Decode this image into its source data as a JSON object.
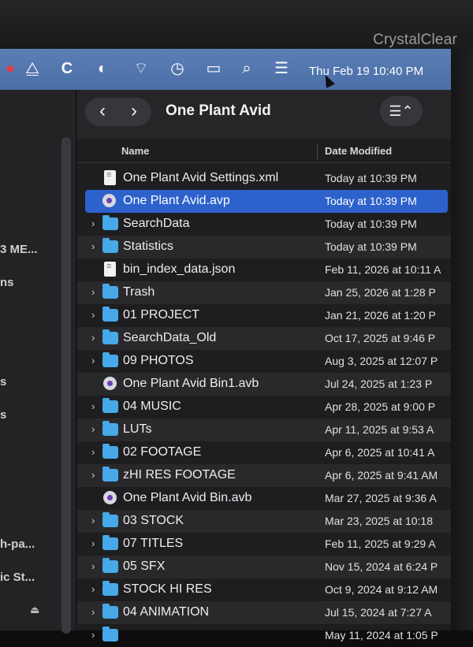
{
  "monitor": {
    "brand": "CrystalClear"
  },
  "menubar": {
    "clock": "Thu Feb 19  10:40 PM",
    "icons": [
      "avid-triangle-icon",
      "c-icon",
      "circle-icon",
      "wifi-off-icon",
      "time-machine-icon",
      "display-icon",
      "search-icon",
      "control-center-icon"
    ]
  },
  "sidebar": {
    "items": [
      "3 ME...",
      "ns",
      "s",
      "s",
      "h-pa...",
      "ic St..."
    ]
  },
  "window": {
    "title": "One Plant Avid",
    "nav": {
      "back": "‹",
      "forward": "›"
    },
    "view_icon": "list-view-icon"
  },
  "columns": {
    "name": "Name",
    "date": "Date Modified"
  },
  "files": [
    {
      "name": "One Plant Avid Settings.xml",
      "date": "Today at 10:39 PM",
      "kind": "doc",
      "folder": false
    },
    {
      "name": "One Plant Avid.avp",
      "date": "Today at 10:39 PM",
      "kind": "avid",
      "folder": false,
      "selected": true
    },
    {
      "name": "SearchData",
      "date": "Today at 10:39 PM",
      "kind": "folder",
      "folder": true
    },
    {
      "name": "Statistics",
      "date": "Today at 10:39 PM",
      "kind": "folder",
      "folder": true
    },
    {
      "name": "bin_index_data.json",
      "date": "Feb 11, 2026 at 10:11 A",
      "kind": "doc",
      "folder": false
    },
    {
      "name": "Trash",
      "date": "Jan 25, 2026 at 1:28 P",
      "kind": "folder",
      "folder": true
    },
    {
      "name": "01 PROJECT",
      "date": "Jan 21, 2026 at 1:20 P",
      "kind": "folder",
      "folder": true
    },
    {
      "name": "SearchData_Old",
      "date": "Oct 17, 2025 at 9:46 P",
      "kind": "folder",
      "folder": true
    },
    {
      "name": "09 PHOTOS",
      "date": "Aug 3, 2025 at 12:07 P",
      "kind": "folder",
      "folder": true
    },
    {
      "name": "One Plant Avid Bin1.avb",
      "date": "Jul 24, 2025 at 1:23 P",
      "kind": "avid",
      "folder": false
    },
    {
      "name": "04 MUSIC",
      "date": "Apr 28, 2025 at 9:00 P",
      "kind": "folder",
      "folder": true
    },
    {
      "name": "LUTs",
      "date": "Apr 11, 2025 at 9:53 A",
      "kind": "folder",
      "folder": true
    },
    {
      "name": "02 FOOTAGE",
      "date": "Apr 6, 2025 at 10:41 A",
      "kind": "folder",
      "folder": true
    },
    {
      "name": "zHI RES FOOTAGE",
      "date": "Apr 6, 2025 at 9:41 AM",
      "kind": "folder",
      "folder": true
    },
    {
      "name": "One Plant Avid Bin.avb",
      "date": "Mar 27, 2025 at 9:36 A",
      "kind": "avid",
      "folder": false
    },
    {
      "name": "03 STOCK",
      "date": "Mar 23, 2025 at 10:18",
      "kind": "folder",
      "folder": true
    },
    {
      "name": "07 TITLES",
      "date": "Feb 11, 2025 at 9:29 A",
      "kind": "folder",
      "folder": true
    },
    {
      "name": "05 SFX",
      "date": "Nov 15, 2024 at 6:24 P",
      "kind": "folder",
      "folder": true
    },
    {
      "name": "STOCK HI RES",
      "date": "Oct 9, 2024 at 9:12 AM",
      "kind": "folder",
      "folder": true
    },
    {
      "name": "04 ANIMATION",
      "date": "Jul 15, 2024 at 7:27 A",
      "kind": "folder",
      "folder": true
    },
    {
      "name": "",
      "date": "May 11, 2024 at 1:05 P",
      "kind": "folder",
      "folder": true
    }
  ]
}
